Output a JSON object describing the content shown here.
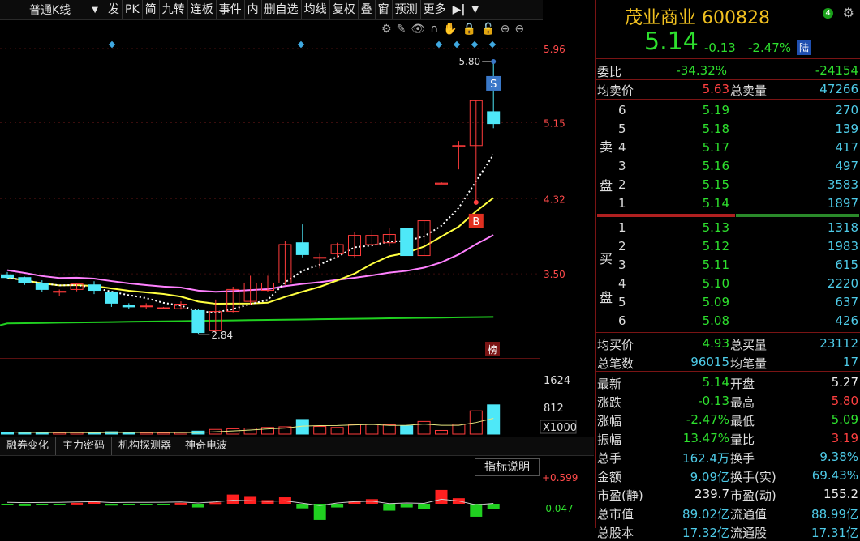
{
  "toolbar": {
    "period": "普通K线",
    "buttons": [
      "发",
      "PK",
      "简",
      "九转",
      "连板",
      "事件",
      "内",
      "删自选",
      "均线",
      "复权",
      "叠",
      "窗",
      "预测",
      "更多"
    ],
    "end": "▶|"
  },
  "chart": {
    "price_labels": [
      "5.96",
      "5.15",
      "4.32",
      "3.50"
    ],
    "high_label": "5.80",
    "low_label": "2.84",
    "markers": {
      "s": "S",
      "b": "B",
      "bang": "榜"
    },
    "volume_labels": [
      "1624",
      "812",
      "X1000"
    ],
    "tabs": [
      "融券变化",
      "主力密码",
      "机构探测器",
      "神奇电波"
    ],
    "indicator_button": "指标说明",
    "indicator_labels": [
      "+0.599",
      "-0.047"
    ],
    "colors": {
      "up": "#ff3b3b",
      "down": "#4ee8f8",
      "ma5": "#ffffff",
      "ma10": "#ffff40",
      "ma20": "#ff80ff",
      "ma60": "#20d020"
    }
  },
  "chart_data": {
    "type": "candlestick",
    "ylim": [
      2.6,
      6.1
    ],
    "candles": [
      {
        "o": 3.49,
        "h": 3.52,
        "l": 3.44,
        "c": 3.46
      },
      {
        "o": 3.46,
        "h": 3.47,
        "l": 3.38,
        "c": 3.4
      },
      {
        "o": 3.4,
        "h": 3.43,
        "l": 3.3,
        "c": 3.33
      },
      {
        "o": 3.3,
        "h": 3.33,
        "l": 3.26,
        "c": 3.31
      },
      {
        "o": 3.33,
        "h": 3.4,
        "l": 3.31,
        "c": 3.39
      },
      {
        "o": 3.38,
        "h": 3.42,
        "l": 3.28,
        "c": 3.32
      },
      {
        "o": 3.3,
        "h": 3.31,
        "l": 3.14,
        "c": 3.18
      },
      {
        "o": 3.16,
        "h": 3.18,
        "l": 3.12,
        "c": 3.14
      },
      {
        "o": 3.15,
        "h": 3.18,
        "l": 3.12,
        "c": 3.15
      },
      {
        "o": 3.13,
        "h": 3.14,
        "l": 3.12,
        "c": 3.13
      },
      {
        "o": 3.12,
        "h": 3.2,
        "l": 3.11,
        "c": 3.17
      },
      {
        "o": 3.1,
        "h": 3.12,
        "l": 2.84,
        "c": 2.86
      },
      {
        "o": 2.88,
        "h": 3.22,
        "l": 2.86,
        "c": 3.09
      },
      {
        "o": 3.09,
        "h": 3.36,
        "l": 3.08,
        "c": 3.33
      },
      {
        "o": 3.2,
        "h": 3.48,
        "l": 3.16,
        "c": 3.4
      },
      {
        "o": 3.32,
        "h": 3.48,
        "l": 3.3,
        "c": 3.4
      },
      {
        "o": 3.4,
        "h": 3.86,
        "l": 3.38,
        "c": 3.82
      },
      {
        "o": 3.84,
        "h": 4.04,
        "l": 3.68,
        "c": 3.71
      },
      {
        "o": 3.68,
        "h": 3.72,
        "l": 3.56,
        "c": 3.68
      },
      {
        "o": 3.72,
        "h": 3.84,
        "l": 3.68,
        "c": 3.82
      },
      {
        "o": 3.7,
        "h": 3.96,
        "l": 3.68,
        "c": 3.92
      },
      {
        "o": 3.82,
        "h": 3.98,
        "l": 3.8,
        "c": 3.92
      },
      {
        "o": 3.84,
        "h": 4.0,
        "l": 3.8,
        "c": 3.93
      },
      {
        "o": 4.0,
        "h": 4.0,
        "l": 3.7,
        "c": 3.7
      },
      {
        "o": 3.7,
        "h": 4.08,
        "l": 3.7,
        "c": 4.08
      },
      {
        "o": 4.48,
        "h": 4.5,
        "l": 4.48,
        "c": 4.49
      },
      {
        "o": 4.89,
        "h": 4.95,
        "l": 4.64,
        "c": 4.9
      },
      {
        "o": 4.9,
        "h": 5.39,
        "l": 4.28,
        "c": 5.39
      },
      {
        "o": 5.27,
        "h": 5.8,
        "l": 5.09,
        "c": 5.14
      }
    ],
    "volume": [
      60,
      45,
      40,
      38,
      42,
      55,
      70,
      40,
      38,
      36,
      45,
      90,
      140,
      160,
      180,
      200,
      220,
      440,
      230,
      200,
      290,
      300,
      280,
      250,
      380,
      110,
      300,
      700,
      880
    ],
    "vol_max": 1800,
    "indicator": [
      -0.02,
      -0.05,
      -0.03,
      -0.02,
      0.02,
      0.05,
      -0.04,
      -0.02,
      -0.02,
      -0.01,
      0.02,
      -0.08,
      0.03,
      0.2,
      0.15,
      0.08,
      0.14,
      -0.1,
      -0.35,
      -0.08,
      0.05,
      0.1,
      -0.15,
      -0.08,
      -0.12,
      0.3,
      0.12,
      -0.28,
      -0.12
    ],
    "ind_range": [
      -0.45,
      0.65
    ]
  },
  "quote": {
    "name": "茂业商业 600828",
    "badge": "4",
    "price": "5.14",
    "change": "-0.13",
    "pct": "-2.47%",
    "lu": "陆",
    "weibi_label": "委比",
    "weibi_pct": "-34.32%",
    "weibi_val": "-24154",
    "avg_sell_label": "均卖价",
    "avg_sell": "5.63",
    "total_sell_label": "总卖量",
    "total_sell": "47266",
    "sell_side": "卖盘",
    "asks": [
      {
        "level": "6",
        "price": "5.19",
        "vol": "270"
      },
      {
        "level": "5",
        "price": "5.18",
        "vol": "139"
      },
      {
        "level": "4",
        "price": "5.17",
        "vol": "417"
      },
      {
        "level": "3",
        "price": "5.16",
        "vol": "497"
      },
      {
        "level": "2",
        "price": "5.15",
        "vol": "3583"
      },
      {
        "level": "1",
        "price": "5.14",
        "vol": "1897"
      }
    ],
    "buy_side": "买盘",
    "bids": [
      {
        "level": "1",
        "price": "5.13",
        "vol": "1318"
      },
      {
        "level": "2",
        "price": "5.12",
        "vol": "1983"
      },
      {
        "level": "3",
        "price": "5.11",
        "vol": "615"
      },
      {
        "level": "4",
        "price": "5.10",
        "vol": "2220"
      },
      {
        "level": "5",
        "price": "5.09",
        "vol": "637"
      },
      {
        "level": "6",
        "price": "5.08",
        "vol": "426"
      }
    ],
    "avg_buy_label": "均买价",
    "avg_buy": "4.93",
    "total_buy_label": "总买量",
    "total_buy": "23112",
    "trades_label": "总笔数",
    "trades": "96015",
    "avg_lot_label": "均笔量",
    "avg_lot": "17",
    "stats": [
      {
        "l1": "最新",
        "v1": "5.14",
        "c1": "g",
        "l2": "开盘",
        "v2": "5.27",
        "c2": "w"
      },
      {
        "l1": "涨跌",
        "v1": "-0.13",
        "c1": "g",
        "l2": "最高",
        "v2": "5.80",
        "c2": "r"
      },
      {
        "l1": "涨幅",
        "v1": "-2.47%",
        "c1": "g",
        "l2": "最低",
        "v2": "5.09",
        "c2": "g"
      },
      {
        "l1": "振幅",
        "v1": "13.47%",
        "c1": "g",
        "l2": "量比",
        "v2": "3.19",
        "c2": "r"
      },
      {
        "l1": "总手",
        "v1": "162.4万",
        "c1": "c",
        "l2": "换手",
        "v2": "9.38%",
        "c2": "c"
      },
      {
        "l1": "金额",
        "v1": "9.09亿",
        "c1": "c",
        "l2": "换手(实)",
        "v2": "69.43%",
        "c2": "c"
      },
      {
        "l1": "市盈(静)",
        "v1": "239.7",
        "c1": "w",
        "l2": "市盈(动)",
        "v2": "155.2",
        "c2": "w"
      },
      {
        "l1": "总市值",
        "v1": "89.02亿",
        "c1": "c",
        "l2": "流通值",
        "v2": "88.99亿",
        "c2": "c"
      },
      {
        "l1": "总股本",
        "v1": "17.32亿",
        "c1": "c",
        "l2": "流通股",
        "v2": "17.31亿",
        "c2": "c"
      }
    ]
  }
}
